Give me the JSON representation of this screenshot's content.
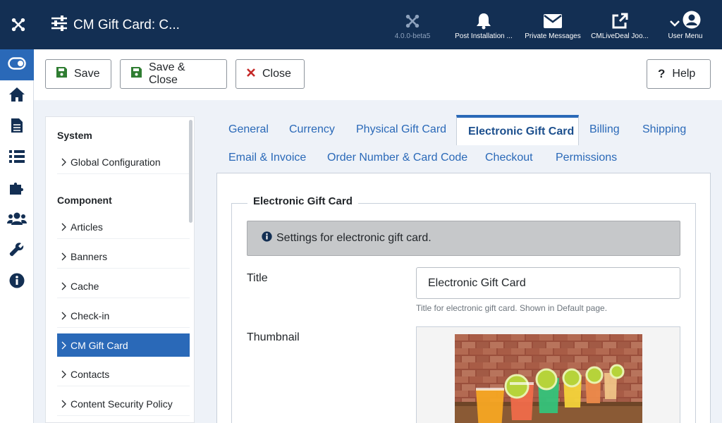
{
  "header": {
    "title": "CM Gift Card: C...",
    "version": "4.0.0-beta5",
    "post_installation": "Post Installation ...",
    "private_messages": "Private Messages",
    "site_link": "CMLiveDeal Joo...",
    "user_menu": "User Menu"
  },
  "sidebar": {
    "icons": [
      "toggle-menu-icon",
      "home-icon",
      "content-icon",
      "menus-icon",
      "extensions-icon",
      "users-icon",
      "system-icon",
      "help-info-icon"
    ]
  },
  "toolbar": {
    "save": "Save",
    "save_close": "Save & Close",
    "close": "Close",
    "help": "Help"
  },
  "tree": {
    "system_heading": "System",
    "global_configuration": "Global Configuration",
    "component_heading": "Component",
    "items": [
      "Articles",
      "Banners",
      "Cache",
      "Check-in",
      "CM Gift Card",
      "Contacts",
      "Content Security Policy"
    ],
    "active_item": "CM Gift Card"
  },
  "tabs": {
    "general": "General",
    "currency": "Currency",
    "physical": "Physical Gift Card",
    "electronic": "Electronic Gift Card",
    "billing": "Billing",
    "shipping": "Shipping",
    "email": "Email & Invoice",
    "order_number": "Order Number & Card Code",
    "checkout": "Checkout",
    "permissions": "Permissions",
    "active": "Electronic Gift Card"
  },
  "form": {
    "legend": "Electronic Gift Card",
    "alert": "Settings for electronic gift card.",
    "title_label": "Title",
    "title_value": "Electronic Gift Card",
    "title_help": "Title for electronic gift card. Shown in Default page.",
    "thumbnail_label": "Thumbnail"
  },
  "colors": {
    "header_bg": "#132f53",
    "accent": "#2a69b8",
    "save_green": "#2f7d32",
    "close_red": "#c52827"
  }
}
